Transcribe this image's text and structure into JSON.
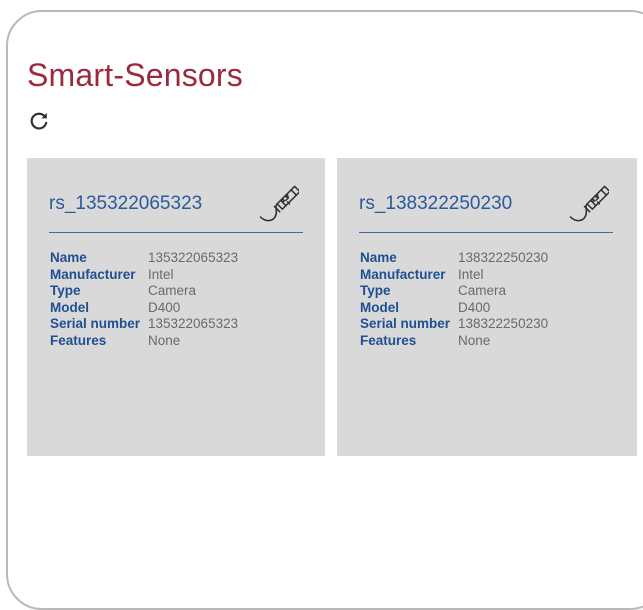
{
  "page": {
    "title": "Smart-Sensors"
  },
  "toolbar": {
    "refresh_icon": "refresh-icon"
  },
  "sensors": [
    {
      "id": "rs_135322065323",
      "icon": "usb-icon",
      "properties": [
        {
          "label": "Name",
          "value": "135322065323"
        },
        {
          "label": "Manufacturer",
          "value": "Intel"
        },
        {
          "label": "Type",
          "value": "Camera"
        },
        {
          "label": "Model",
          "value": "D400"
        },
        {
          "label": "Serial number",
          "value": "135322065323"
        },
        {
          "label": "Features",
          "value": "None"
        }
      ]
    },
    {
      "id": "rs_138322250230",
      "icon": "usb-icon",
      "properties": [
        {
          "label": "Name",
          "value": "138322250230"
        },
        {
          "label": "Manufacturer",
          "value": "Intel"
        },
        {
          "label": "Type",
          "value": "Camera"
        },
        {
          "label": "Model",
          "value": "D400"
        },
        {
          "label": "Serial number",
          "value": "138322250230"
        },
        {
          "label": "Features",
          "value": "None"
        }
      ]
    }
  ],
  "colors": {
    "title": "#9b2a3c",
    "card_bg": "#d9d9d9",
    "card_title": "#2a5a9c",
    "label": "#1f4f93",
    "value": "#6a6a6a"
  }
}
